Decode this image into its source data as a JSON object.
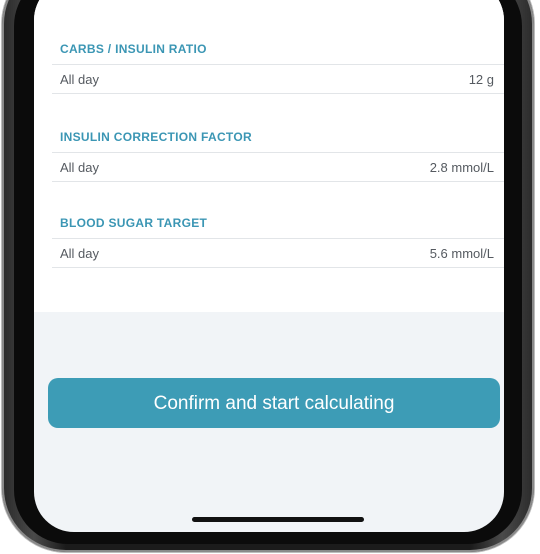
{
  "sections": [
    {
      "title": "CARBS / INSULIN RATIO",
      "row_label": "All day",
      "row_value": "12 g"
    },
    {
      "title": "INSULIN CORRECTION FACTOR",
      "row_label": "All day",
      "row_value": "2.8 mmol/L"
    },
    {
      "title": "BLOOD SUGAR TARGET",
      "row_label": "All day",
      "row_value": "5.6 mmol/L"
    }
  ],
  "confirm_button": {
    "label": "Confirm and start calculating"
  },
  "colors": {
    "accent": "#3d9cb6",
    "section_header": "#3b96b4",
    "screen_background": "#f1f4f7"
  }
}
